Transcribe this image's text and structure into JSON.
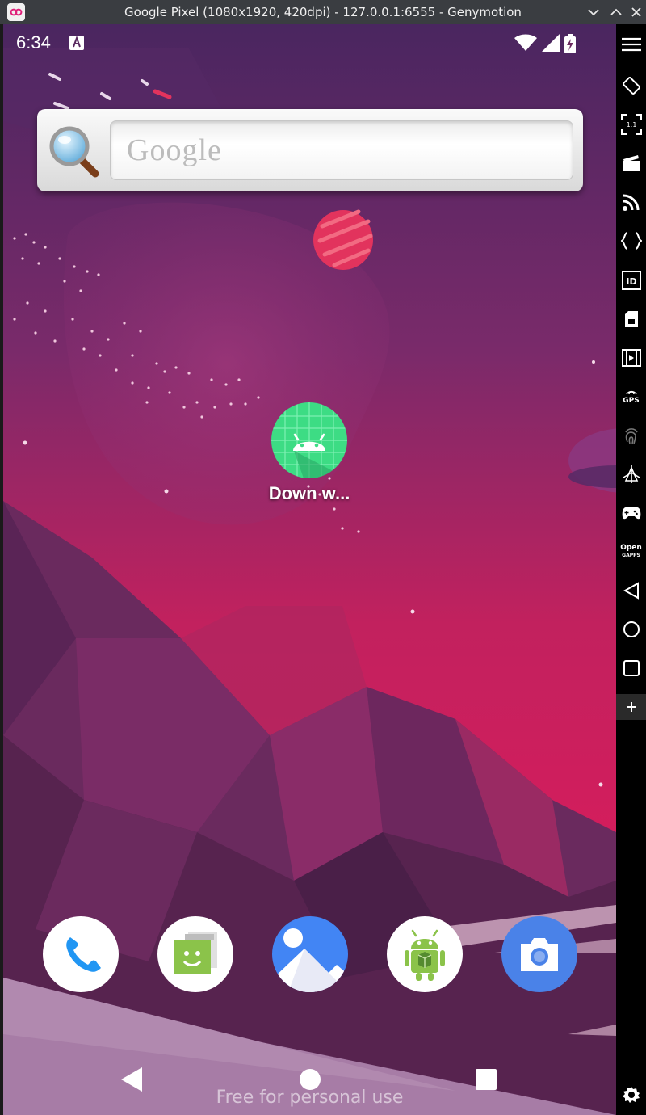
{
  "window": {
    "title": "Google Pixel (1080x1920, 420dpi) - 127.0.0.1:6555 - Genymotion"
  },
  "status_bar": {
    "time": "6:34"
  },
  "search_widget": {
    "placeholder": "Google"
  },
  "home_app": {
    "label": "Down w..."
  },
  "dock": {
    "apps": [
      "phone-icon",
      "messaging-icon",
      "gallery-icon",
      "android-app-icon",
      "camera-icon"
    ]
  },
  "footer": {
    "watermark": "Free for personal use"
  },
  "toolbar": {
    "open_gapps": "Open",
    "open_gapps_sub": "GAPPS",
    "gps": "GPS",
    "ratio": "1:1"
  },
  "colors": {
    "title_bar": "#3a3d41",
    "wallpaper_top": "#5e2a63",
    "wallpaper_pink": "#d61f5c",
    "toolbar": "#000000"
  }
}
